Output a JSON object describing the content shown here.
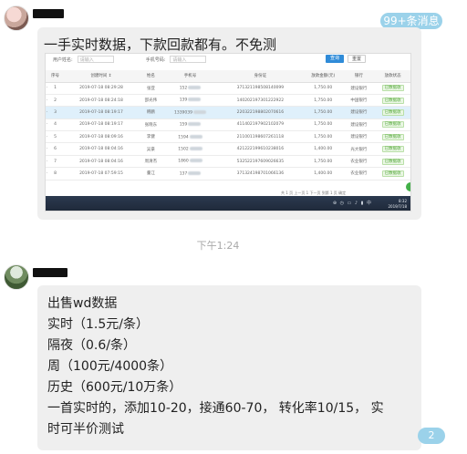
{
  "top_badge": "99+条消息",
  "bottom_badge": "2",
  "message1": {
    "caption": "一手实时数据，下款回款都有。不免测",
    "screenshot": {
      "filter_label_1": "用户姓名:",
      "filter_placeholder_1": "请输入",
      "filter_label_2": "手机号码:",
      "filter_placeholder_2": "请输入",
      "query_button": "查询",
      "reset_button": "重置",
      "columns": [
        "",
        "序号",
        "创建时间 ↕",
        "姓名",
        "手机号",
        "身份证",
        "放款金额(元)",
        "银行",
        "放款状态"
      ],
      "rows": [
        {
          "no": "1",
          "time": "2019-07-18 08:29:28",
          "name": "张亚",
          "phone": "152",
          "id": "371321198508140099",
          "amount": "1,750.00",
          "bank": "建设银行",
          "status": "已数据收"
        },
        {
          "no": "2",
          "time": "2019-07-18 08:24:18",
          "name": "邵光伟",
          "phone": "139",
          "id": "140202197301222922",
          "amount": "1,750.00",
          "bank": "中国银行",
          "status": "已数据收"
        },
        {
          "no": "3",
          "time": "2019-07-18 08:19:17",
          "name": "韩鹏",
          "phone": "1339039",
          "id": "220322198802070616",
          "amount": "1,750.00",
          "bank": "建设银行",
          "status": "已数据收"
        },
        {
          "no": "4",
          "time": "2019-07-18 08:19:17",
          "name": "张晓东",
          "phone": "159",
          "id": "411402197902102079",
          "amount": "1,750.00",
          "bank": "建设银行",
          "status": "已数据收"
        },
        {
          "no": "5",
          "time": "2019-07-18 08:09:16",
          "name": "李健",
          "phone": "1594",
          "id": "211001198607261118",
          "amount": "1,750.00",
          "bank": "建设银行",
          "status": "已数据收"
        },
        {
          "no": "6",
          "time": "2019-07-18 08:04:16",
          "name": "吴豪",
          "phone": "1502",
          "id": "421222199610238016",
          "amount": "1,400.00",
          "bank": "光大银行",
          "status": "已数据收"
        },
        {
          "no": "7",
          "time": "2019-07-18 08:04:16",
          "name": "周清杰",
          "phone": "1860",
          "id": "532522197609026635",
          "amount": "1,750.00",
          "bank": "农业银行",
          "status": "已数据收"
        },
        {
          "no": "8",
          "time": "2019-07-18 07:59:15",
          "name": "董江",
          "phone": "137",
          "id": "371324198701066136",
          "amount": "1,400.00",
          "bank": "农业银行",
          "status": "已数据收"
        }
      ],
      "pager": "共 1 页 上一页 1 下一页 到第 1 页 确定",
      "tray": "⊕ ◷ ▭ ♪ ▮ 中",
      "clock_time": "8:32",
      "clock_date": "2019/7/18"
    }
  },
  "time_label": "下午1:24",
  "message2": {
    "lines": [
      "出售wd数据",
      "实时（1.5元/条）",
      "隔夜（0.6/条）",
      "周（100元/4000条）",
      "历史（600元/10万条）",
      "一首实时的，添加10-20，接通60-70，       转化率10/15，      实",
      "时可半价测试"
    ]
  }
}
